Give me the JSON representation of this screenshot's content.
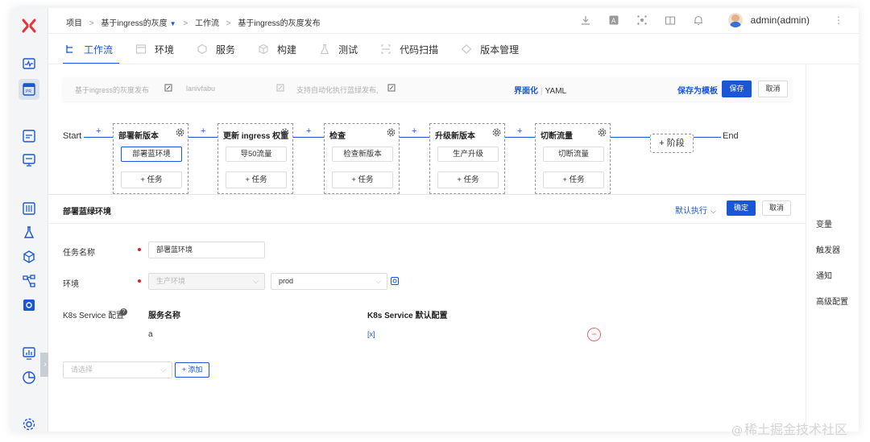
{
  "breadcrumb": {
    "items": [
      "项目",
      "基于ingress的灰度",
      "工作流",
      "基于ingress的灰度发布"
    ],
    "separator": ">"
  },
  "user": {
    "name": "admin(admin)"
  },
  "tabs": [
    "工作流",
    "环境",
    "服务",
    "构建",
    "测试",
    "代码扫描",
    "版本管理"
  ],
  "active_tab_index": 0,
  "workflow_header": {
    "display_name": "基于ingress的灰度发布",
    "key": "lanivfabu",
    "description": "支持自动化执行蓝绿发布,",
    "mode_ui": "界面化",
    "mode_yaml": "YAML",
    "save_template": "保存为模板",
    "save": "保存",
    "cancel": "取消"
  },
  "pipeline": {
    "start": "Start",
    "end": "End",
    "add_stage": "+ 阶段",
    "plus": "+",
    "stages": [
      {
        "name": "部署新版本",
        "job": "部署蓝环境",
        "add_task": "+ 任务"
      },
      {
        "name": "更新 ingress 权重",
        "job": "导50流量",
        "add_task": "+ 任务"
      },
      {
        "name": "检查",
        "job": "检查新版本",
        "add_task": "+ 任务"
      },
      {
        "name": "升级新版本",
        "job": "生产升级",
        "add_task": "+ 任务"
      },
      {
        "name": "切断流量",
        "job": "切断流量",
        "add_task": "+ 任务"
      }
    ]
  },
  "detail": {
    "title": "部署蓝绿环境",
    "exec_mode": "默认执行",
    "confirm": "确定",
    "cancel": "取消",
    "task_name_label": "任务名称",
    "task_name_value": "部署蓝环境",
    "env_label": "环境",
    "env_value": "生产环境",
    "namespace_value": "prod",
    "k8s_label": "K8s Service 配置",
    "col_service": "服务名称",
    "col_default": "K8s Service 默认配置",
    "rows": [
      {
        "service": "a",
        "config": "[x]"
      }
    ],
    "select_placeholder": "请选择",
    "add_button": "+ 添加"
  },
  "right_panel": [
    "变量",
    "触发器",
    "通知",
    "高级配置"
  ],
  "watermark": {
    "at": "@",
    "text": "稀土掘金技术社区"
  },
  "colors": {
    "accent": "#1a56d6",
    "danger": "#e02020",
    "logo": "#e8333a"
  }
}
